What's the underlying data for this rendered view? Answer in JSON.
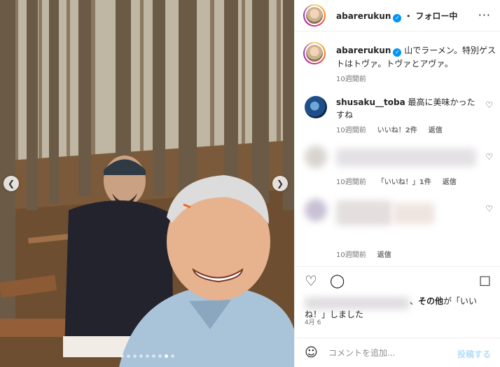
{
  "post": {
    "username": "abarerukun",
    "follow_status": "・ フォロー中",
    "more_icon": "more-options-icon",
    "caption": "山でラーメン。特別ゲストはトヴァ。トヴァとアヴァ。",
    "caption_time": "10週間前"
  },
  "comments": [
    {
      "username": "shusaku__toba",
      "text": "最高に美味かったすね",
      "time": "10週間前",
      "likes": "いいね！2件",
      "reply": "返信"
    },
    {
      "username": "",
      "text": "",
      "time": "10週間前",
      "likes": "「いいね！」1件",
      "reply": "返信"
    },
    {
      "username": "",
      "text": "",
      "time": "10週間前",
      "likes": "",
      "reply": "返信"
    }
  ],
  "likes_summary": {
    "suffix_comma": "、",
    "others": "その他",
    "text": "が「いいね！」しました"
  },
  "date": "4月 6",
  "comment_box": {
    "placeholder": "コメントを追加...",
    "post_label": "投稿する"
  },
  "carousel": {
    "slide_count": 9,
    "active_index": 7
  },
  "colors": {
    "verified": "#0095f6",
    "post_disabled": "#b2dffc"
  }
}
